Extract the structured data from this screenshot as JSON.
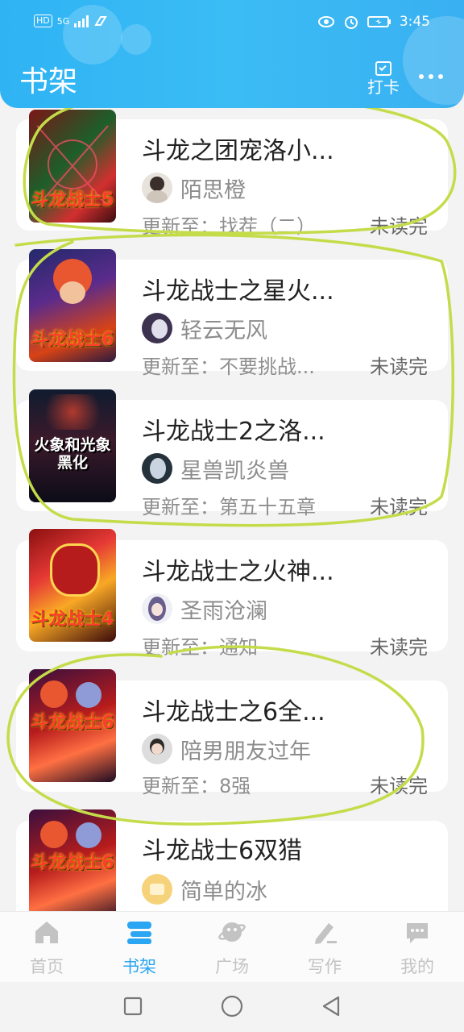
{
  "status_bar": {
    "hd": "HD",
    "network": "5G",
    "time": "3:45"
  },
  "header": {
    "title": "书架",
    "checkin_label": "打卡"
  },
  "books": [
    {
      "title": "斗龙之团宠洛小...",
      "author": "陌思橙",
      "update": "更新至：找茬（二）",
      "status": "未读完",
      "cover_colors": [
        "#6b0f12",
        "#e0312a",
        "#2b8a3e"
      ],
      "cover_text": "斗龙战士5"
    },
    {
      "title": "斗龙战士之星火...",
      "author": "轻云无风",
      "update": "更新至：不要挑战...",
      "status": "未读完",
      "cover_colors": [
        "#1a1a4a",
        "#d84315",
        "#ffb300"
      ],
      "cover_text": "斗龙战士6"
    },
    {
      "title": "斗龙战士2之洛...",
      "author": "星兽凯炎兽",
      "update": "更新至：第五十五章",
      "status": "未读完",
      "cover_colors": [
        "#0e1f3a",
        "#7a1f2c",
        "#d6a021"
      ],
      "cover_text": "火象和光象黑化"
    },
    {
      "title": "斗龙战士之火神...",
      "author": "圣雨沧澜",
      "update": "更新至：通知",
      "status": "未读完",
      "cover_colors": [
        "#7a0d0d",
        "#e53935",
        "#fbc02d"
      ],
      "cover_text": "斗龙战士4"
    },
    {
      "title": "斗龙战士之6全...",
      "author": "陪男朋友过年",
      "update": "更新至：8强",
      "status": "未读完",
      "cover_colors": [
        "#2a0d2e",
        "#c62828",
        "#ff8a65"
      ],
      "cover_text": "斗龙战士6"
    },
    {
      "title": "斗龙战士6双猎",
      "author": "简单的冰",
      "update": "",
      "status": "",
      "cover_colors": [
        "#2a0d2e",
        "#c62828",
        "#ff8a65"
      ],
      "cover_text": "斗龙战士6"
    }
  ],
  "tabs": [
    {
      "label": "首页",
      "icon": "home-icon"
    },
    {
      "label": "书架",
      "icon": "bookshelf-icon"
    },
    {
      "label": "广场",
      "icon": "planet-icon"
    },
    {
      "label": "写作",
      "icon": "pen-icon"
    },
    {
      "label": "我的",
      "icon": "chat-bubble-icon"
    }
  ],
  "colors": {
    "header_blue": "#36b6f4",
    "tab_active": "#2aa6f2",
    "tab_inactive": "#c3c3c3",
    "annotation": "#c4dc4a"
  }
}
